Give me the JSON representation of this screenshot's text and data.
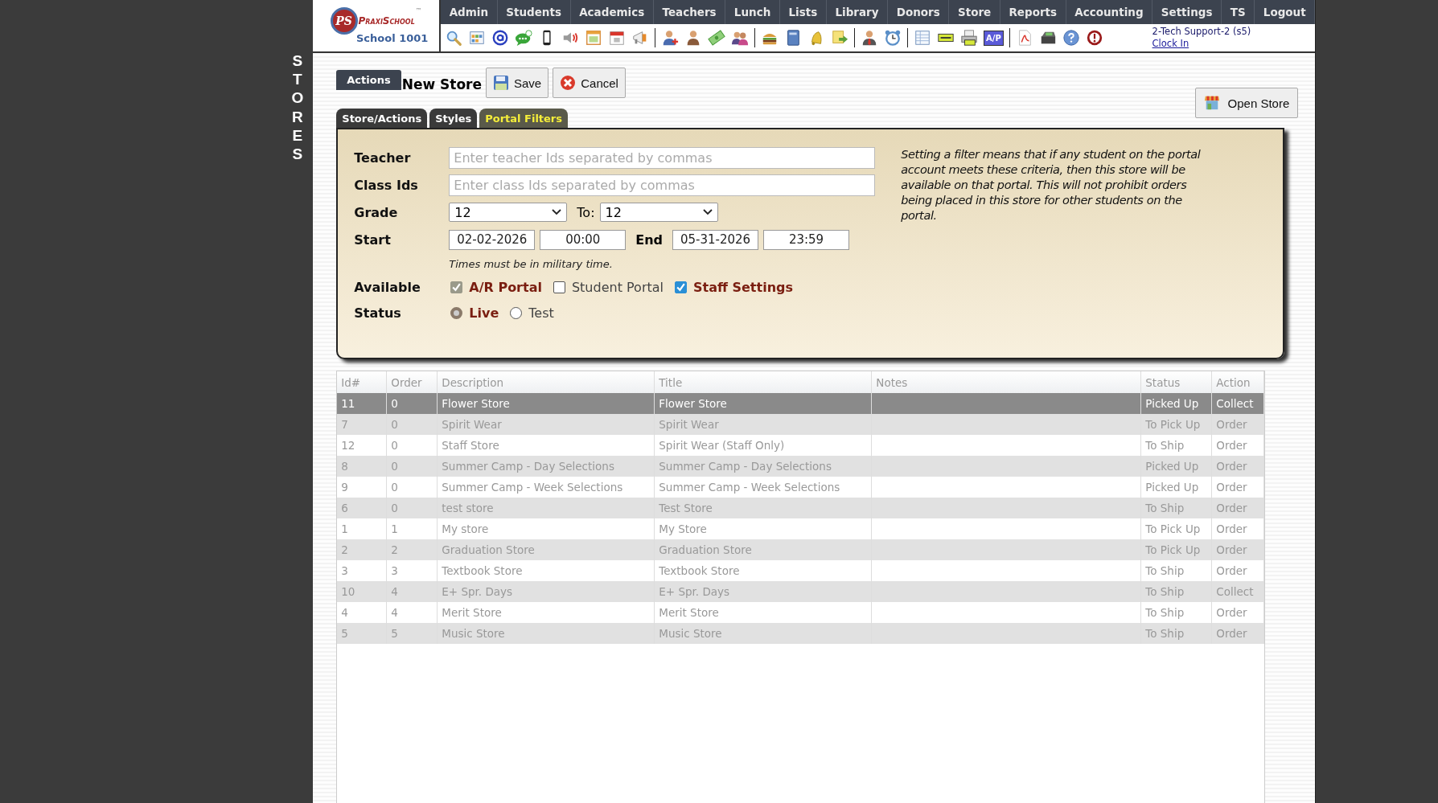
{
  "side_label": "STORES",
  "logo": {
    "initials": "PS",
    "brand": "PraxiSchool",
    "trademark": "™",
    "school": "School 1001"
  },
  "nav": [
    {
      "label": "Admin"
    },
    {
      "label": "Students"
    },
    {
      "label": "Academics"
    },
    {
      "label": "Teachers"
    },
    {
      "label": "Lunch"
    },
    {
      "label": "Lists"
    },
    {
      "label": "Library"
    },
    {
      "label": "Donors"
    },
    {
      "label": "Store"
    },
    {
      "label": "Reports"
    },
    {
      "label": "Accounting"
    },
    {
      "label": "Settings"
    },
    {
      "label": "TS"
    },
    {
      "label": "Logout"
    }
  ],
  "toolbar": {
    "ap_label": "A/P"
  },
  "user": {
    "name": "2-Tech Support-2 (s5)",
    "clock_link": "Clock In"
  },
  "actions": {
    "label": "Actions",
    "title": "New Store",
    "buttons": [
      {
        "label": "Save",
        "kind": "save"
      },
      {
        "label": "Cancel",
        "kind": "cancel"
      }
    ]
  },
  "open_store_button": "Open Store",
  "tabs": [
    {
      "label": "Store/Actions",
      "selected": false
    },
    {
      "label": "Styles",
      "selected": false
    },
    {
      "label": "Portal Filters",
      "selected": true
    }
  ],
  "filters": {
    "teacher": {
      "label": "Teacher",
      "placeholder": "Enter teacher Ids separated by commas"
    },
    "class_ids": {
      "label": "Class Ids",
      "placeholder": "Enter class Ids separated by commas"
    },
    "grade": {
      "label": "Grade",
      "from": "12",
      "to_label": "To:",
      "to": "12"
    },
    "start": {
      "label": "Start",
      "date": "02-02-2026",
      "time": "00:00"
    },
    "end": {
      "label": "End",
      "date": "05-31-2026",
      "time": "23:59"
    },
    "time_note": "Times must be in military time.",
    "available": {
      "label": "Available",
      "options": [
        {
          "label": "A/R Portal",
          "checked": true,
          "disabled": true
        },
        {
          "label": "Student Portal",
          "checked": false,
          "disabled": false
        },
        {
          "label": "Staff Settings",
          "checked": true,
          "disabled": false
        }
      ]
    },
    "status": {
      "label": "Status",
      "options": [
        {
          "label": "Live",
          "selected": true
        },
        {
          "label": "Test",
          "selected": false
        }
      ]
    },
    "help_text": "Setting a filter means that if any student on the portal account meets these criteria, then this store will be available on that portal. This will not prohibit orders being placed in this store for other students on the portal."
  },
  "table": {
    "columns": [
      "Id#",
      "Order",
      "Description",
      "Title",
      "Notes",
      "Status",
      "Action"
    ],
    "rows": [
      {
        "cells": [
          "11",
          "0",
          "Flower Store",
          "Flower Store",
          "",
          "Picked Up",
          "Collect"
        ],
        "selected": true
      },
      {
        "cells": [
          "7",
          "0",
          "Spirit Wear",
          "Spirit Wear",
          "",
          "To Pick Up",
          "Order"
        ],
        "selected": false
      },
      {
        "cells": [
          "12",
          "0",
          "Staff Store",
          "Spirit Wear (Staff Only)",
          "",
          "To Ship",
          "Order"
        ],
        "selected": false
      },
      {
        "cells": [
          "8",
          "0",
          "Summer Camp - Day Selections",
          "Summer Camp - Day Selections",
          "",
          "Picked Up",
          "Order"
        ],
        "selected": false
      },
      {
        "cells": [
          "9",
          "0",
          "Summer Camp - Week Selections",
          "Summer Camp - Week Selections",
          "",
          "Picked Up",
          "Order"
        ],
        "selected": false
      },
      {
        "cells": [
          "6",
          "0",
          "test store",
          "Test Store",
          "",
          "To Ship",
          "Order"
        ],
        "selected": false
      },
      {
        "cells": [
          "1",
          "1",
          "My store",
          "My Store",
          "",
          "To Pick Up",
          "Order"
        ],
        "selected": false
      },
      {
        "cells": [
          "2",
          "2",
          "Graduation Store",
          "Graduation Store",
          "",
          "To Pick Up",
          "Order"
        ],
        "selected": false
      },
      {
        "cells": [
          "3",
          "3",
          "Textbook Store",
          "Textbook Store",
          "",
          "To Ship",
          "Order"
        ],
        "selected": false
      },
      {
        "cells": [
          "10",
          "4",
          "E+ Spr. Days",
          "E+ Spr. Days",
          "",
          "To Ship",
          "Collect"
        ],
        "selected": false
      },
      {
        "cells": [
          "4",
          "4",
          "Merit Store",
          "Merit Store",
          "",
          "To Ship",
          "Order"
        ],
        "selected": false
      },
      {
        "cells": [
          "5",
          "5",
          "Music Store",
          "Music Store",
          "",
          "To Ship",
          "Order"
        ],
        "selected": false
      }
    ]
  }
}
